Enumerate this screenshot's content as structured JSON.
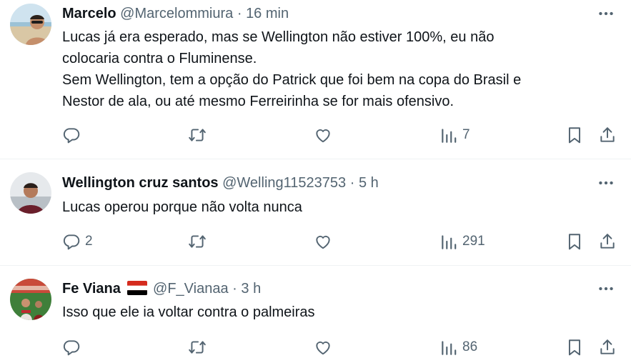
{
  "tweets": [
    {
      "name": "Marcelo",
      "handle": "@Marcelommiura",
      "time": "16 min",
      "lines": [
        "Lucas já era esperado, mas se Wellington não estiver 100%, eu não",
        "colocaria contra o Fluminense.",
        "Sem Wellington, tem a opção do Patrick que foi bem na copa do Brasil e",
        "Nestor de ala, ou até mesmo Ferreirinha se for mais ofensivo."
      ],
      "replies": "",
      "retweets": "",
      "likes": "",
      "views": "7"
    },
    {
      "name": "Wellington cruz santos",
      "handle": "@Welling11523753",
      "time": "5 h",
      "lines": [
        "Lucas  operou  porque não volta nunca"
      ],
      "replies": "2",
      "retweets": "",
      "likes": "",
      "views": "291"
    },
    {
      "name": "Fe Viana",
      "handle": "@F_Vianaa",
      "time": "3 h",
      "lines": [
        "Isso que ele ia voltar contra o palmeiras"
      ],
      "replies": "",
      "retweets": "",
      "likes": "",
      "views": "86"
    }
  ],
  "separator": "·",
  "icons": {
    "reply": "reply-icon",
    "retweet": "retweet-icon",
    "like": "heart-icon",
    "views": "views-icon",
    "bookmark": "bookmark-icon",
    "share": "share-icon",
    "more": "more-icon",
    "flag": "flag-icon"
  },
  "colors": {
    "text": "#0f1419",
    "secondary": "#536471",
    "divider": "#eff3f4"
  }
}
